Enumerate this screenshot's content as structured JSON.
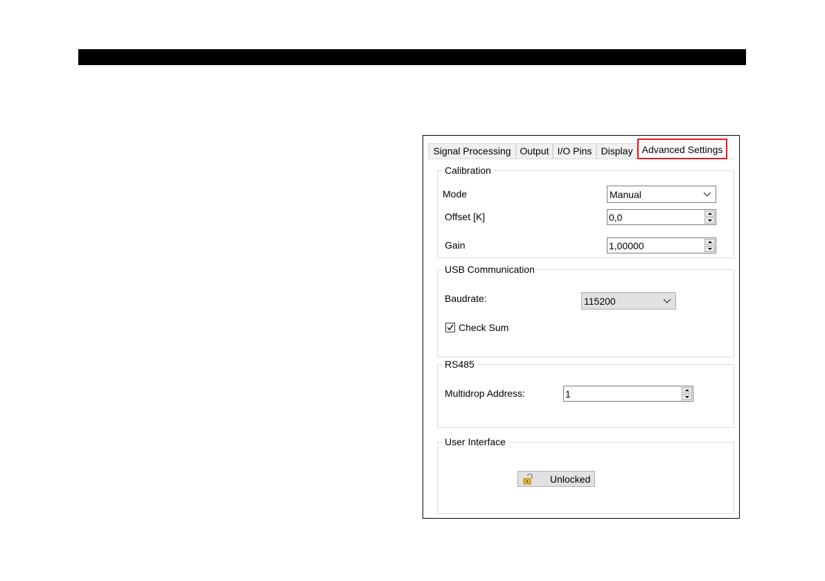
{
  "tabs": [
    {
      "label": "Signal Processing"
    },
    {
      "label": "Output"
    },
    {
      "label": "I/O Pins"
    },
    {
      "label": "Display"
    },
    {
      "label": "Advanced Settings",
      "active": true
    }
  ],
  "calibration": {
    "title": "Calibration",
    "mode_label": "Mode",
    "mode_value": "Manual",
    "offset_label": "Offset [K]",
    "offset_value": "0,0",
    "gain_label": "Gain",
    "gain_value": "1,00000"
  },
  "usb": {
    "title": "USB Communication",
    "baudrate_label": "Baudrate:",
    "baudrate_value": "115200",
    "checksum_label": "Check Sum",
    "checksum_checked": true
  },
  "rs485": {
    "title": "RS485",
    "address_label": "Multidrop Address:",
    "address_value": "1"
  },
  "ui": {
    "title": "User Interface",
    "lock_button_label": "Unlocked",
    "lock_icon": "unlocked-padlock-icon"
  },
  "colors": {
    "highlight": "#e0161e",
    "top_bar": "#000000"
  }
}
